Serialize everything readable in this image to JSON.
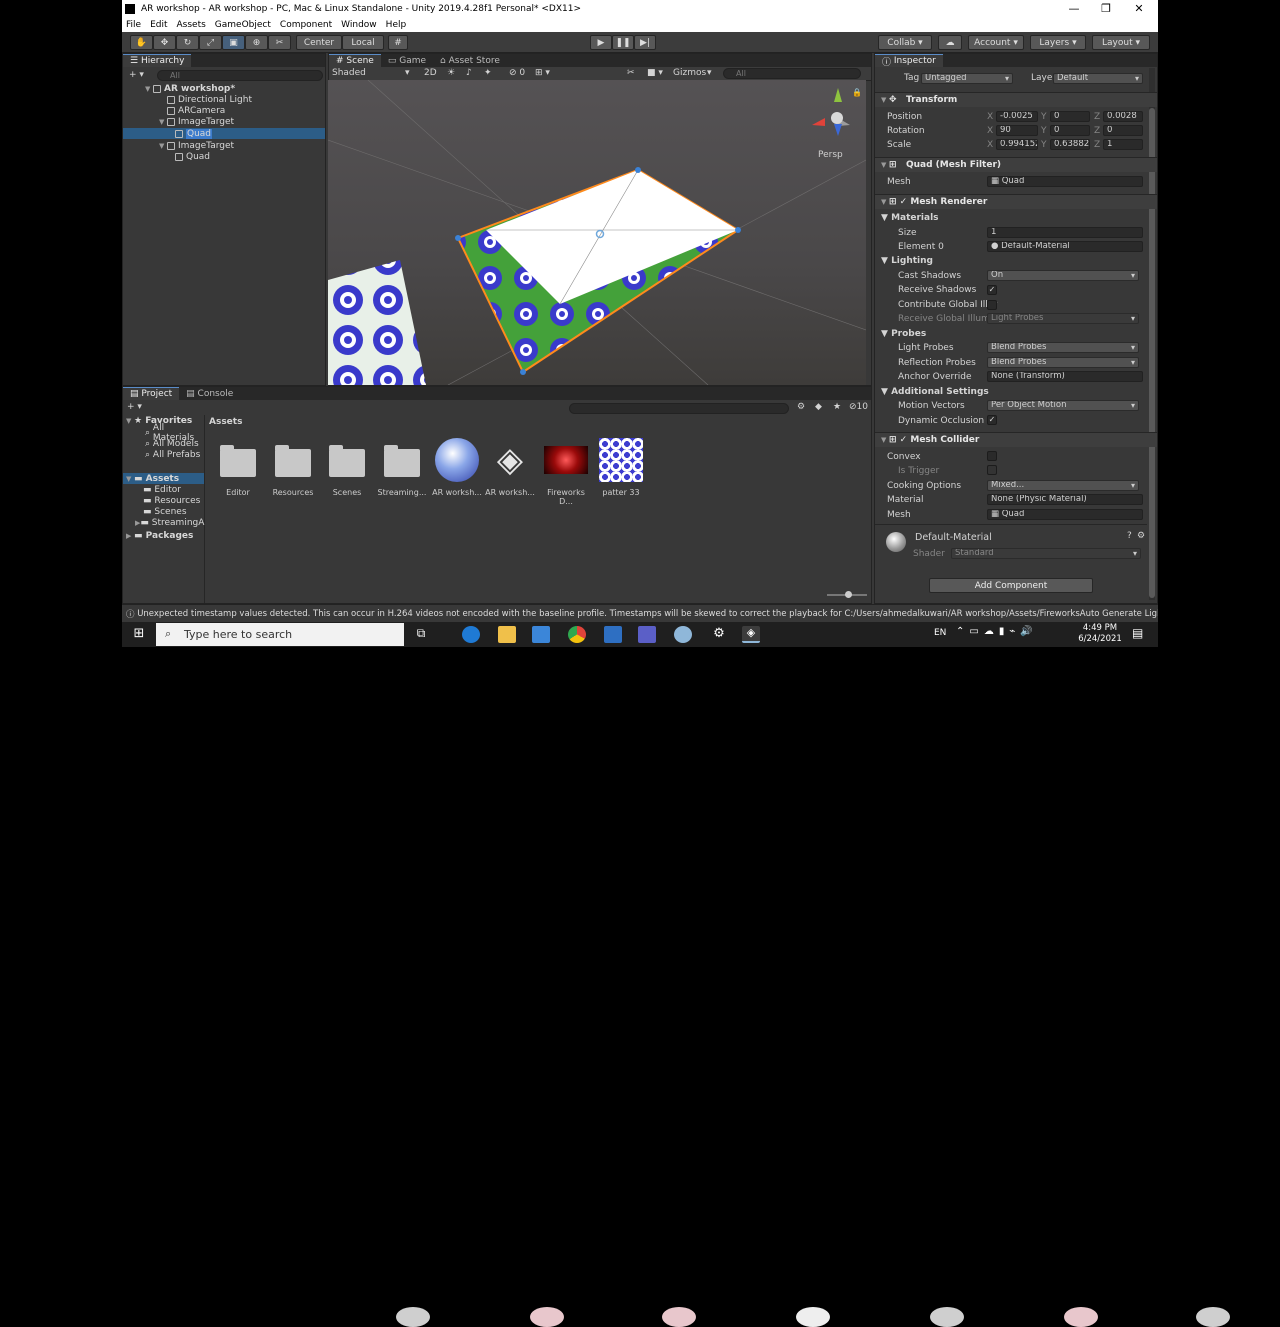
{
  "window": {
    "title": "AR workshop - AR workshop - PC, Mac & Linux Standalone - Unity 2019.4.28f1 Personal* <DX11>",
    "controls": {
      "minimize": "—",
      "maximize": "❐",
      "close": "✕"
    }
  },
  "menu": [
    "File",
    "Edit",
    "Assets",
    "GameObject",
    "Component",
    "Window",
    "Help"
  ],
  "toolbar": {
    "pivot": "Center",
    "space": "Local",
    "collab": "Collab ▾",
    "account": "Account",
    "layers": "Layers",
    "layout": "Layout"
  },
  "hierarchy": {
    "tab": "Hierarchy",
    "search_placeholder": "All",
    "add": "+ ▾",
    "scene": "AR workshop*",
    "items": [
      {
        "label": "Directional Light",
        "indent": 1
      },
      {
        "label": "ARCamera",
        "indent": 1
      },
      {
        "label": "ImageTarget",
        "indent": 1
      },
      {
        "label": "Quad",
        "indent": 2
      },
      {
        "label": "ImageTarget",
        "indent": 1
      },
      {
        "label": "Quad",
        "indent": 2
      }
    ]
  },
  "scene": {
    "tabs": [
      "Scene",
      "Game",
      "Asset Store"
    ],
    "shading": "Shaded",
    "mode2d": "2D",
    "fx_count": "0",
    "gizmos": "Gizmos",
    "search_placeholder": "All",
    "persp": "Persp"
  },
  "project": {
    "tabs": [
      "Project",
      "Console"
    ],
    "add": "+ ▾",
    "hidden_count": "10",
    "favorites_header": "Favorites",
    "favorites": [
      "All Materials",
      "All Models",
      "All Prefabs"
    ],
    "assets_header": "Assets",
    "asset_folders": [
      "Editor",
      "Resources",
      "Scenes",
      "StreamingA"
    ],
    "packages_header": "Packages",
    "breadcrumb": "Assets",
    "items": [
      "Editor",
      "Resources",
      "Scenes",
      "Streaming...",
      "AR worksh...",
      "AR worksh...",
      "Fireworks D...",
      "patter 33"
    ]
  },
  "inspector": {
    "tab": "Inspector",
    "tag_label": "Tag",
    "tag_value": "Untagged",
    "layer_label": "Layer",
    "layer_value": "Default",
    "transform": {
      "header": "Transform",
      "position_label": "Position",
      "rotation_label": "Rotation",
      "scale_label": "Scale",
      "position": [
        "-0.0025",
        "0",
        "0.0028"
      ],
      "rotation": [
        "90",
        "0",
        "0"
      ],
      "scale": [
        "0.994152",
        "0.638826",
        "1"
      ]
    },
    "mesh_filter": {
      "header": "Quad (Mesh Filter)",
      "mesh_label": "Mesh",
      "mesh_value": "Quad"
    },
    "mesh_renderer": {
      "header": "Mesh Renderer",
      "materials": "Materials",
      "size_label": "Size",
      "size_value": "1",
      "element0_label": "Element 0",
      "element0_value": "Default-Material",
      "lighting": "Lighting",
      "cast_shadows_label": "Cast Shadows",
      "cast_shadows_value": "On",
      "receive_shadows_label": "Receive Shadows",
      "contribute_gi_label": "Contribute Global Illur",
      "receive_gi_label": "Receive Global Illumin",
      "receive_gi_value": "Light Probes",
      "probes": "Probes",
      "light_probes_label": "Light Probes",
      "light_probes_value": "Blend Probes",
      "reflection_probes_label": "Reflection Probes",
      "reflection_probes_value": "Blend Probes",
      "anchor_override_label": "Anchor Override",
      "anchor_override_value": "None (Transform)",
      "additional": "Additional Settings",
      "motion_vectors_label": "Motion Vectors",
      "motion_vectors_value": "Per Object Motion",
      "dynamic_occlusion_label": "Dynamic Occlusion"
    },
    "mesh_collider": {
      "header": "Mesh Collider",
      "convex_label": "Convex",
      "is_trigger_label": "Is Trigger",
      "cooking_label": "Cooking Options",
      "cooking_value": "Mixed...",
      "material_label": "Material",
      "material_value": "None (Physic Material)",
      "mesh_label": "Mesh",
      "mesh_value": "Quad"
    },
    "material": {
      "name": "Default-Material",
      "shader_label": "Shader",
      "shader_value": "Standard"
    },
    "add_component": "Add Component"
  },
  "status": "Unexpected timestamp values detected. This can occur in H.264 videos not encoded with the baseline profile. Timestamps will be skewed to correct the playback for C:/Users/ahmedalkuwari/AR workshop/Assets/FireworksAuto Generate Lighting Off",
  "taskbar": {
    "search_placeholder": "Type here to search",
    "lang": "EN",
    "time": "4:49 PM",
    "date": "6/24/2021"
  }
}
